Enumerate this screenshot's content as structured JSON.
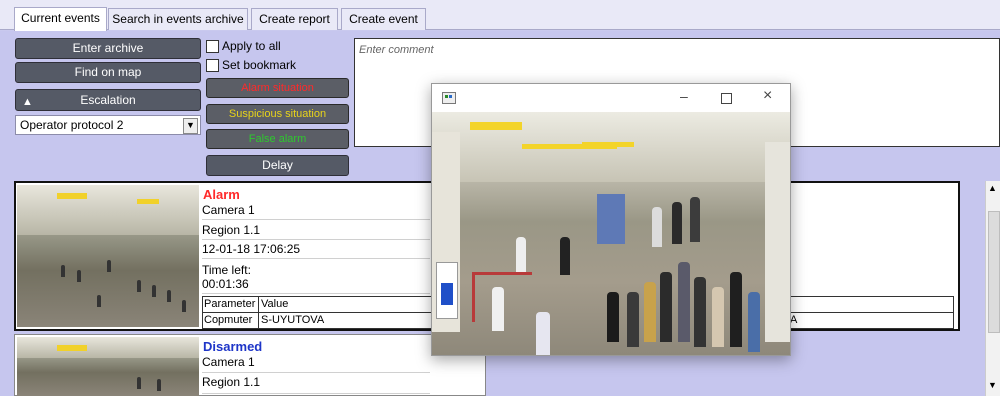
{
  "tabs": [
    {
      "label": "Current events",
      "active": true
    },
    {
      "label": "Search in events archive",
      "active": false
    },
    {
      "label": "Create report",
      "active": false
    },
    {
      "label": "Create event",
      "active": false
    }
  ],
  "controls": {
    "enter_archive": "Enter archive",
    "find_on_map": "Find on map",
    "escalation": "Escalation",
    "protocol_selected": "Operator protocol 2",
    "apply_to_all": "Apply to all",
    "set_bookmark": "Set bookmark",
    "alarm_situation": "Alarm situation",
    "suspicious_situation": "Suspicious situation",
    "false_alarm": "False alarm",
    "delay": "Delay",
    "comment_placeholder": "Enter comment"
  },
  "colors": {
    "alarm": "#ff2a2a",
    "suspicious": "#e8d41a",
    "false_alarm": "#2ec82e",
    "disarmed": "#1e35c8"
  },
  "events": [
    {
      "status": "Alarm",
      "camera": "Camera 1",
      "region": "Region 1.1",
      "datetime": "12-01-18 17:06:25",
      "time_left_label": "Time left:",
      "time_left": "00:01:36",
      "param_header": "Parameter",
      "value_header": "Value",
      "param_name": "Copmuter",
      "param_value": "S-UYUTOVA",
      "param_value_tail": "A"
    },
    {
      "status": "Disarmed",
      "camera": "Camera 1",
      "region": "Region 1.1"
    }
  ],
  "popup": {
    "icons": [
      "app-icon",
      "minimize-icon",
      "maximize-icon",
      "close-icon"
    ]
  }
}
